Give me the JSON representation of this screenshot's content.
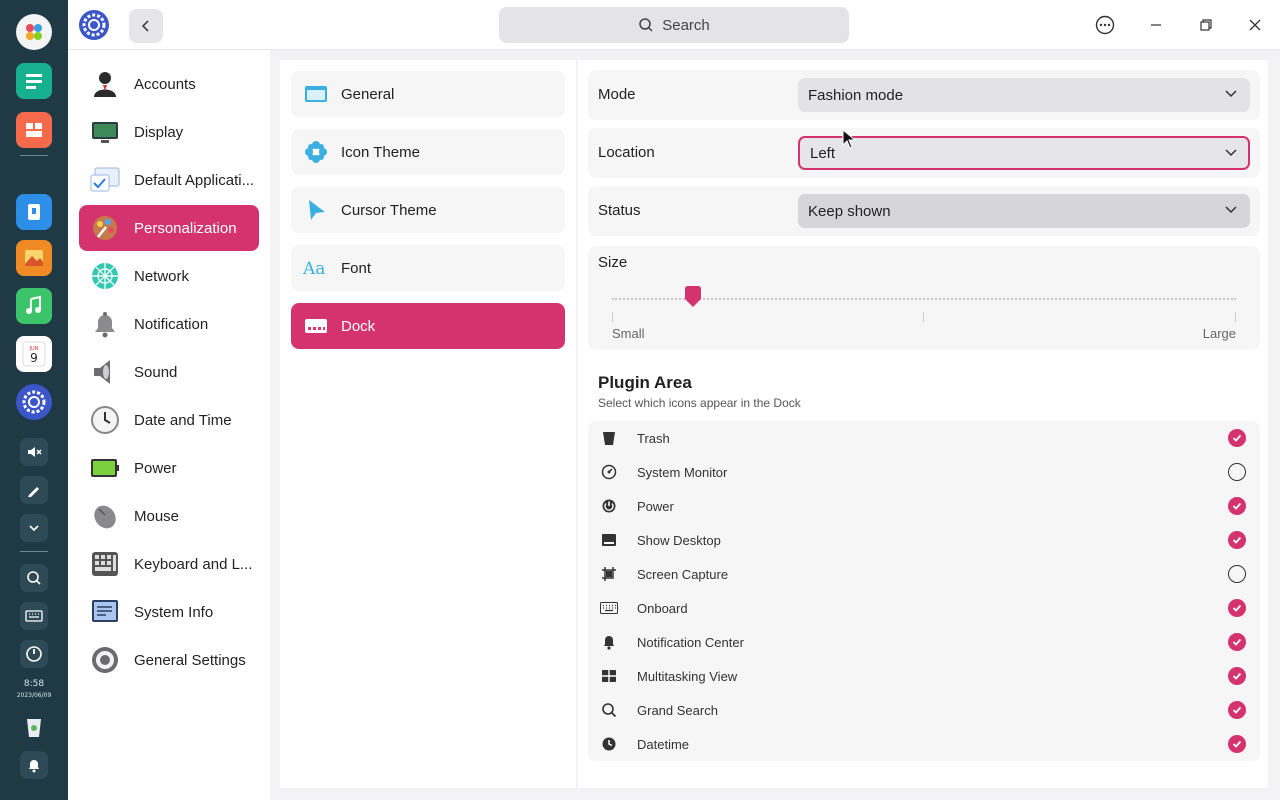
{
  "dock": {
    "time": "8:58",
    "date": "2023/06/09"
  },
  "titlebar": {
    "search_placeholder": "Search"
  },
  "sidebar": {
    "items": [
      {
        "label": "Accounts",
        "icon": "accounts-icon"
      },
      {
        "label": "Display",
        "icon": "display-icon"
      },
      {
        "label": "Default Applicati...",
        "icon": "default-apps-icon"
      },
      {
        "label": "Personalization",
        "icon": "personalization-icon"
      },
      {
        "label": "Network",
        "icon": "network-icon"
      },
      {
        "label": "Notification",
        "icon": "notification-icon"
      },
      {
        "label": "Sound",
        "icon": "sound-icon"
      },
      {
        "label": "Date and Time",
        "icon": "clock-icon"
      },
      {
        "label": "Power",
        "icon": "battery-icon"
      },
      {
        "label": "Mouse",
        "icon": "mouse-icon"
      },
      {
        "label": "Keyboard and L...",
        "icon": "keyboard-icon"
      },
      {
        "label": "System Info",
        "icon": "system-info-icon"
      },
      {
        "label": "General Settings",
        "icon": "general-settings-icon"
      }
    ]
  },
  "personalization": {
    "items": [
      {
        "label": "General"
      },
      {
        "label": "Icon Theme"
      },
      {
        "label": "Cursor Theme"
      },
      {
        "label": "Font"
      },
      {
        "label": "Dock"
      }
    ]
  },
  "dock_settings": {
    "mode": {
      "label": "Mode",
      "value": "Fashion mode"
    },
    "location": {
      "label": "Location",
      "value": "Left"
    },
    "status": {
      "label": "Status",
      "value": "Keep shown"
    },
    "size": {
      "label": "Size",
      "min_label": "Small",
      "max_label": "Large",
      "value_fraction": 0.13
    },
    "plugin_area": {
      "title": "Plugin Area",
      "subtitle": "Select which icons appear in the Dock",
      "plugins": [
        {
          "label": "Trash",
          "checked": true
        },
        {
          "label": "System Monitor",
          "checked": false
        },
        {
          "label": "Power",
          "checked": true
        },
        {
          "label": "Show Desktop",
          "checked": true
        },
        {
          "label": "Screen Capture",
          "checked": false
        },
        {
          "label": "Onboard",
          "checked": true
        },
        {
          "label": "Notification Center",
          "checked": true
        },
        {
          "label": "Multitasking View",
          "checked": true
        },
        {
          "label": "Grand Search",
          "checked": true
        },
        {
          "label": "Datetime",
          "checked": true
        }
      ]
    }
  },
  "colors": {
    "accent": "#d5336e",
    "dock_bg": "#1f3a44"
  }
}
